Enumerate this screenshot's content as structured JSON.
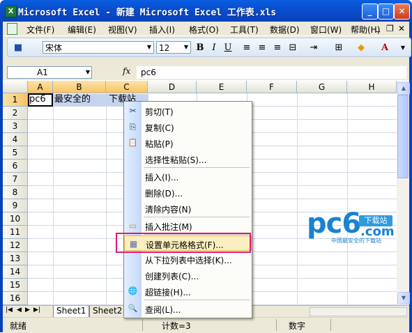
{
  "window": {
    "title": "Microsoft Excel - 新建 Microsoft Excel 工作表.xls",
    "minimize_label": "_",
    "maximize_label": "□",
    "close_label": "✕"
  },
  "menu": [
    "文件(F)",
    "编辑(E)",
    "视图(V)",
    "插入(I)",
    "格式(O)",
    "工具(T)",
    "数据(D)",
    "窗口(W)",
    "帮助(H)"
  ],
  "menu_right": {
    "min": "_",
    "restore": "❐",
    "close": "✕"
  },
  "toolbar": {
    "font_name": "宋体",
    "font_size": "12",
    "bold": "B",
    "italic": "I",
    "underline": "U"
  },
  "formula_bar": {
    "name_box": "A1",
    "fx": "fx",
    "value": "pc6"
  },
  "grid": {
    "columns": [
      "A",
      "B",
      "C",
      "D",
      "E",
      "F",
      "G",
      "H"
    ],
    "rows": [
      "1",
      "2",
      "3",
      "4",
      "5",
      "6",
      "7",
      "8",
      "9",
      "10",
      "11",
      "12",
      "13",
      "14",
      "15",
      "16"
    ],
    "cells": {
      "A1": "pc6",
      "B1": "最安全的",
      "C1": "下载站"
    }
  },
  "sheet_tabs": [
    "Sheet1",
    "Sheet2"
  ],
  "tab_nav": [
    "|◀",
    "◀",
    "▶",
    "▶|"
  ],
  "status": {
    "ready": "就绪",
    "count": "计数=3",
    "num": "数字"
  },
  "context_menu": [
    {
      "label": "剪切(T)",
      "icon": "scissors-icon",
      "glyph": "✂"
    },
    {
      "label": "复制(C)",
      "icon": "copy-icon",
      "glyph": "⎘"
    },
    {
      "label": "粘贴(P)",
      "icon": "paste-icon",
      "glyph": "📋"
    },
    {
      "label": "选择性粘贴(S)...",
      "icon": "",
      "glyph": ""
    },
    {
      "label": "插入(I)...",
      "icon": "",
      "glyph": ""
    },
    {
      "label": "删除(D)...",
      "icon": "",
      "glyph": ""
    },
    {
      "label": "清除内容(N)",
      "icon": "",
      "glyph": ""
    },
    {
      "label": "插入批注(M)",
      "icon": "comment-icon",
      "glyph": "▭"
    },
    {
      "label": "设置单元格格式(F)...",
      "icon": "format-cells-icon",
      "glyph": "▦"
    },
    {
      "label": "从下拉列表中选择(K)...",
      "icon": "",
      "glyph": ""
    },
    {
      "label": "创建列表(C)...",
      "icon": "",
      "glyph": ""
    },
    {
      "label": "超链接(H)...",
      "icon": "hyperlink-icon",
      "glyph": "🌐"
    },
    {
      "label": "查阅(L)...",
      "icon": "research-icon",
      "glyph": "🔍"
    }
  ],
  "watermark": {
    "logo": "pc6",
    "badge": "下载站",
    "domain": ".com",
    "tagline": "中国最安全的下载站"
  }
}
